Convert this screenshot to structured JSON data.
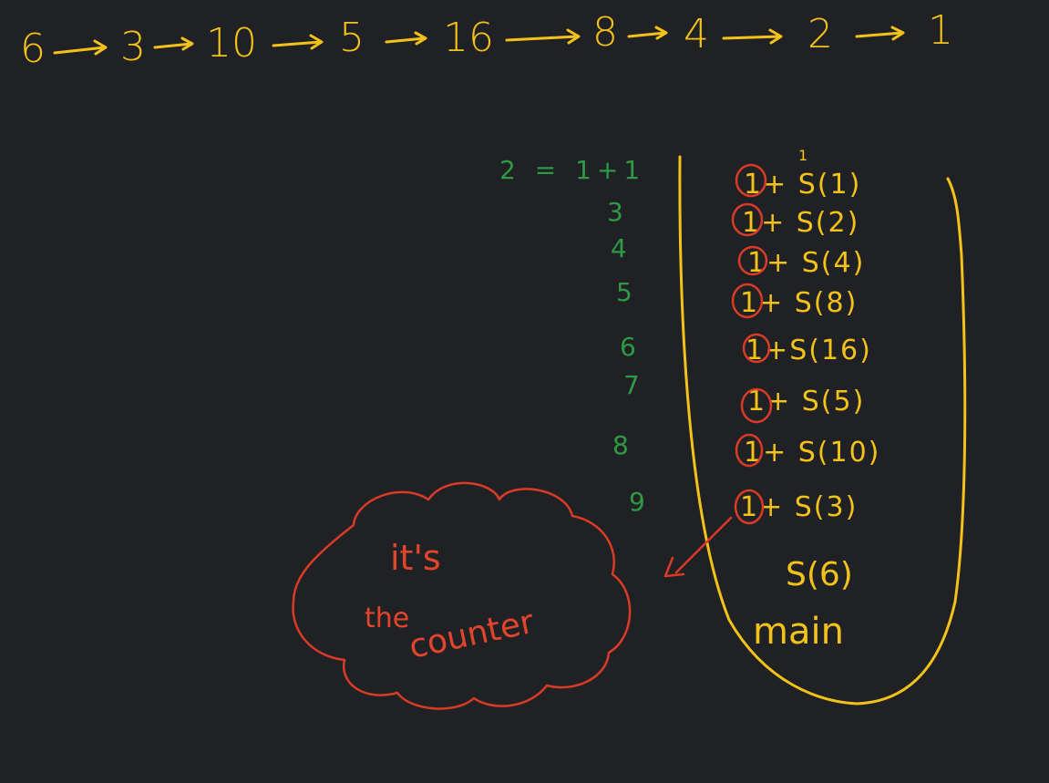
{
  "colors": {
    "background": "#202124",
    "yellow_ink": "#f2c21b",
    "green_ink": "#2e9a45",
    "red_ink": "#d93b26"
  },
  "sequence": {
    "numbers": [
      "6",
      "3",
      "10",
      "5",
      "16",
      "8",
      "4",
      "2",
      "1"
    ]
  },
  "stack": {
    "top_mark": "1",
    "calls": [
      "1+ S(1)",
      "1+ S(2)",
      "1+ S(4)",
      "1+ S(8)",
      "1+S(16)",
      "1+ S(5)",
      "1+ S(10)",
      "1+ S(3)"
    ],
    "base_frames": [
      "S(6)",
      "main"
    ]
  },
  "counter": {
    "labels": [
      "2 = 1+1",
      "3",
      "4",
      "5",
      "6",
      "7",
      "8",
      "9"
    ]
  },
  "note": {
    "line1": "it's",
    "line2": "the",
    "line3": "counter"
  }
}
